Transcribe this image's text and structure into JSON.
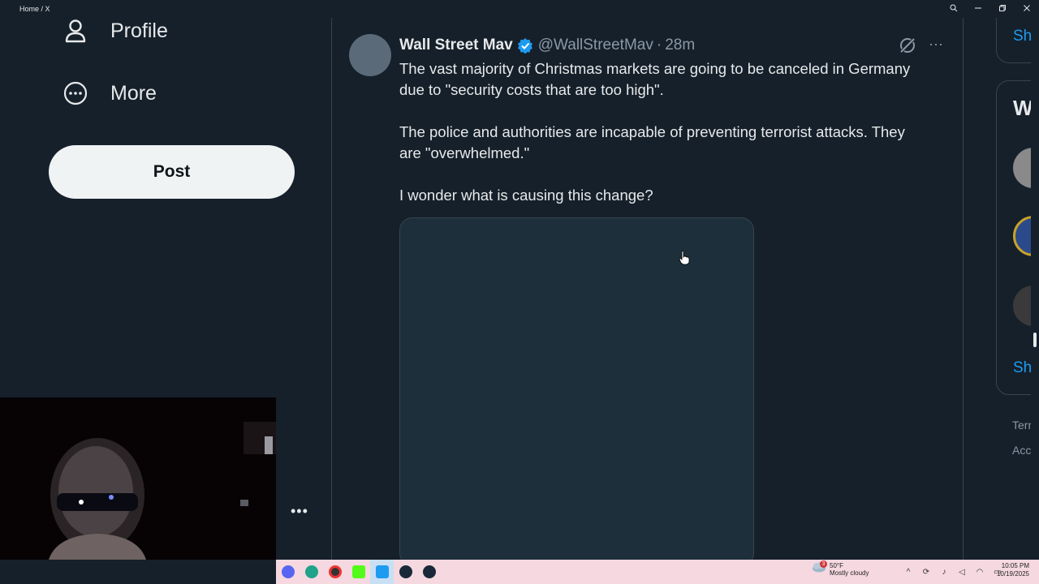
{
  "window": {
    "title": "Home / X"
  },
  "sidebar": {
    "items": [
      {
        "label": "Profile",
        "icon": "person-icon"
      },
      {
        "label": "More",
        "icon": "more-circle-icon"
      }
    ],
    "post_label": "Post",
    "more_dots": "•••"
  },
  "tweet": {
    "name": "Wall Street Mav",
    "handle": "@WallStreetMav",
    "separator": "·",
    "time": "28m",
    "paragraphs": [
      "The vast majority of Christmas markets are going to be canceled in Germany due to \"security costs that are too high\".",
      "The police and authorities are incapable of preventing terrorist attacks. They are \"overwhelmed.\"",
      "I wonder what is causing this change?"
    ],
    "more": "···"
  },
  "right": {
    "show_more_top": "Sh",
    "who_to_follow_partial": "W",
    "show_more_bottom": "Sh",
    "footer_1": "Terr",
    "footer_2": "Acc"
  },
  "taskbar": {
    "weather_temp": "50°F",
    "weather_desc": "Mostly cloudy",
    "weather_badge": "3",
    "time": "10:05 PM",
    "date": "10/19/2025"
  },
  "colors": {
    "background": "#15202b",
    "accent": "#1d9bf0",
    "border": "#38444d"
  }
}
